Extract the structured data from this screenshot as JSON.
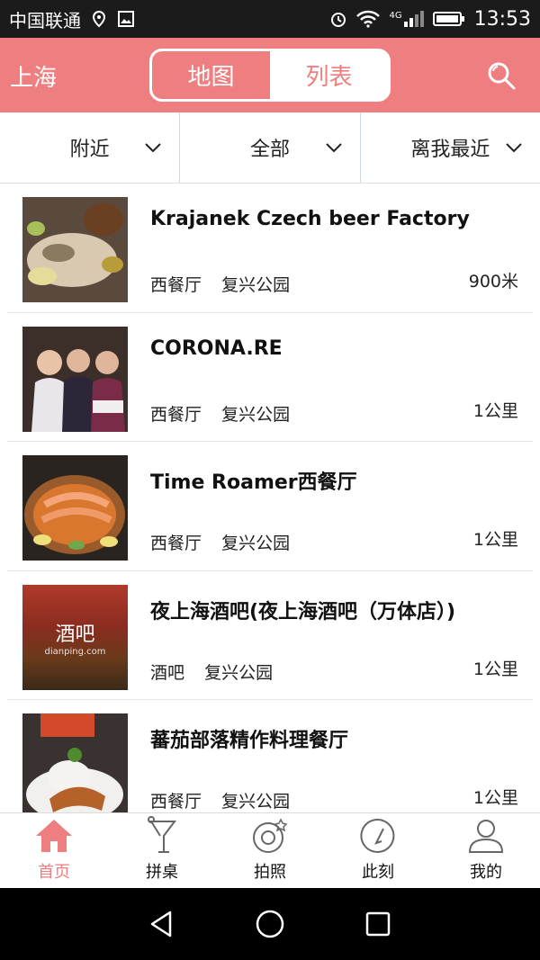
{
  "status": {
    "carrier": "中国联通",
    "network": "4G",
    "time": "13:53"
  },
  "header": {
    "city": "上海",
    "tabs": [
      {
        "label": "地图",
        "active": true
      },
      {
        "label": "列表",
        "active": false
      }
    ],
    "search_icon": "search-icon",
    "accent": "#ee7e7f"
  },
  "filters": [
    {
      "label": "附近"
    },
    {
      "label": "全部"
    },
    {
      "label": "离我最近"
    }
  ],
  "restaurants": [
    {
      "name": "Krajanek Czech beer Factory",
      "category": "西餐厅",
      "area": "复兴公园",
      "distance": "900米"
    },
    {
      "name": "CORONA.RE",
      "category": "西餐厅",
      "area": "复兴公园",
      "distance": "1公里"
    },
    {
      "name": "Time Roamer西餐厅",
      "category": "西餐厅",
      "area": "复兴公园",
      "distance": "1公里"
    },
    {
      "name": "夜上海酒吧(夜上海酒吧（万体店）)",
      "category": "酒吧",
      "area": "复兴公园",
      "distance": "1公里",
      "thumb_text": "酒吧",
      "thumb_sub": "dianping.com"
    },
    {
      "name": "蕃茄部落精作料理餐厅",
      "category": "西餐厅",
      "area": "复兴公园",
      "distance": "1公里"
    }
  ],
  "tabbar": [
    {
      "label": "首页",
      "icon": "home-icon",
      "active": true
    },
    {
      "label": "拼桌",
      "icon": "cocktail-icon",
      "active": false
    },
    {
      "label": "拍照",
      "icon": "camera-ring-icon",
      "active": false
    },
    {
      "label": "此刻",
      "icon": "clock-icon",
      "active": false
    },
    {
      "label": "我的",
      "icon": "user-icon",
      "active": false
    }
  ]
}
